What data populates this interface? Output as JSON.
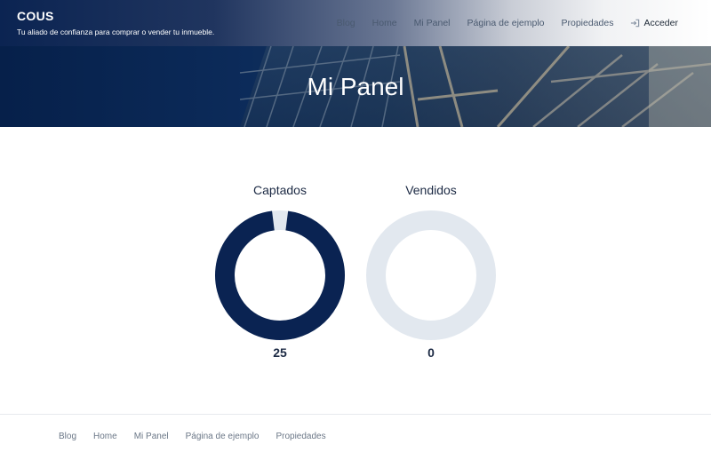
{
  "brand": {
    "name": "COUS",
    "tagline": "Tu aliado de confianza para comprar o vender tu inmueble."
  },
  "nav": {
    "items": [
      "Blog",
      "Home",
      "Mi Panel",
      "Página de ejemplo",
      "Propiedades"
    ],
    "login_label": "Acceder",
    "login_icon": "sign-in-icon"
  },
  "hero": {
    "title": "Mi Panel"
  },
  "stats": [
    {
      "title": "Captados",
      "value": "25",
      "fill_fraction": 0.96,
      "color": "#0a2352",
      "track_color": "#e2e8ef"
    },
    {
      "title": "Vendidos",
      "value": "0",
      "fill_fraction": 0.0,
      "color": "#0a2352",
      "track_color": "#e2e8ef"
    }
  ],
  "footer": {
    "items": [
      "Blog",
      "Home",
      "Mi Panel",
      "Página de ejemplo",
      "Propiedades"
    ]
  }
}
